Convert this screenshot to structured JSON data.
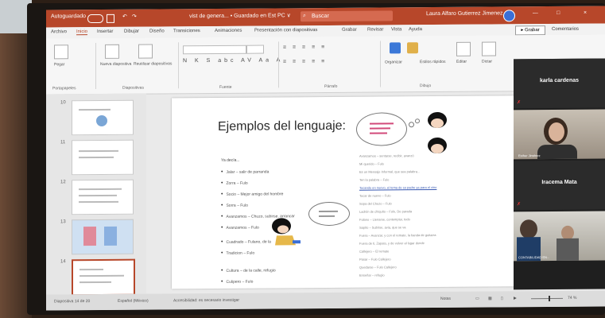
{
  "titlebar": {
    "autosave": "Autoguardado",
    "autosave_state": "●",
    "document": "vist de genera... • Guardado en Est PC ∨",
    "search": "Buscar",
    "user": "Laura Alfaro Gutierrez Jimenez",
    "controls": [
      "—",
      "□",
      "×"
    ]
  },
  "tabs": [
    "Archivo",
    "Inicio",
    "Insertar",
    "Dibujar",
    "Diseño",
    "Transiciones",
    "Animaciones",
    "Presentación con diapositivas",
    "Grabar",
    "Revisar",
    "Vista",
    "Ayuda"
  ],
  "ribbon": {
    "share": "▸ Grabar",
    "comments": "Comentarios",
    "groups": [
      "Portapapeles",
      "Diapositivas",
      "Fuente",
      "Párrafo",
      "Dibujo"
    ],
    "paste": "Pegar",
    "new_slide": "Nueva diapositiva",
    "reuse": "Reutilizar diapositivas",
    "format_row": "N K S abc AV Aa A",
    "para_row": "≡ ≡ ≡ ≡ ≡",
    "para_row2": "≡ ≡ ≡ ≡ ≡",
    "arrange": "Organizar",
    "quick_styles": "Estilos rápidos",
    "edit": "Editar",
    "dictate": "Dictar"
  },
  "thumbnails": [
    "10",
    "11",
    "12",
    "13",
    "14"
  ],
  "slide": {
    "title": "Ejemplos del lenguaje:",
    "intro": "Ya decía...",
    "bullets": [
      "Jalar – salir de parranda",
      "Zorra – Fulo",
      "Socio – Mejor amigo del hombre",
      "Sorra – Fulo",
      "Avanzamos – Chuzo, subirse, arrancar",
      "Avanzamos – Fulo",
      "Cuadrado – Fulano, de la",
      "Tradicion – Fulo",
      "Cultura – de la calle, refugio",
      "Culipero – Fulo"
    ],
    "right_lines": [
      "Avanzamos – sentarse, recibir, avanzó",
      "Mi querido – Fulo",
      "Es un Mensaje Informal, que sea palabra...",
      "Ten la palabra – Fulo",
      "Tocando en nuevo, el tema de su padre ya para el vino",
      "Tocar de nuevo – Fulo",
      "Sopa del Chuzo – Fulo",
      "Ladrón de chiquito – Fulo, De parada",
      "Fulano – Llenarse, contemplar, todo",
      "Sapito – Subirse, avia, que se va",
      "Fuera – Avanzar, y con el remate, la banda de guitarra",
      "Fuera de ti, Zapato, y de volver al lugar donde",
      "Callejero – El remate",
      "Pasar – Fulo Callejero",
      "Quedarse – Fulo Callejero",
      "Enseñar – refugio"
    ]
  },
  "video": {
    "tile1_name": "karla cardenas",
    "tile3_name": "Iracema Mata",
    "tile2_caption": "Esther Jiménez",
    "tile4_caption": "CONTABILIDAD EN..."
  },
  "statusbar": {
    "slide": "Diapositiva 14 de 20",
    "language": "Español (México)",
    "accessibility": "Accesibilidad: es necesario investigar",
    "notes": "Notas",
    "zoom": "74 %"
  },
  "colors": {
    "accent": "#b7472a",
    "video_bg": "#1f1f1f"
  }
}
